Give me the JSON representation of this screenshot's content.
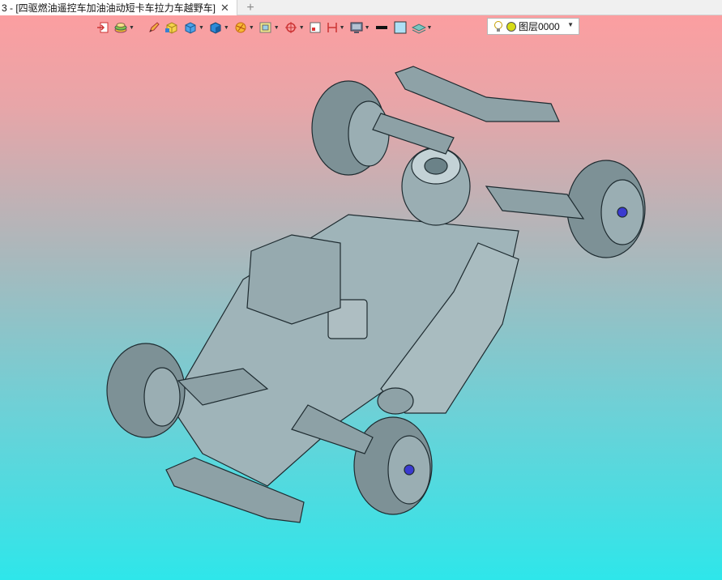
{
  "tab": {
    "title": "3 - [四驱燃油遥控车加油油动短卡车拉力车越野车]",
    "close": "✕",
    "add": "+"
  },
  "toolbar": {
    "items": [
      "exit-icon",
      "layers-stack-icon",
      "pencil-icon",
      "box-yellow-icon",
      "cube-blue-icon",
      "cube-shaded-icon",
      "sun-render-icon",
      "frame-icon",
      "crosshair-icon",
      "grid-icon",
      "dimension-icon",
      "display-icon",
      "line-color-icon",
      "fill-color-icon",
      "stack-icon"
    ],
    "layer_label": "图层0000",
    "colors": {
      "bulb": "#f4d21c",
      "light": "#c8d400"
    }
  },
  "model": {
    "description_color": "#8ea4aa"
  }
}
